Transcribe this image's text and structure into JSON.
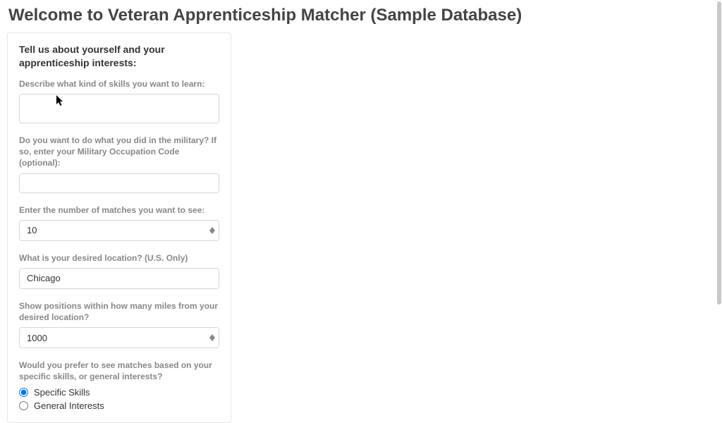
{
  "page": {
    "title": "Welcome to Veteran Apprenticeship Matcher (Sample Database)"
  },
  "form": {
    "intro": "Tell us about yourself and your apprenticeship interests:",
    "skills": {
      "label": "Describe what kind of skills you want to learn:",
      "value": ""
    },
    "military_code": {
      "label": "Do you want to do what you did in the military? If so, enter your Military Occupation Code (optional):",
      "value": ""
    },
    "num_matches": {
      "label": "Enter the number of matches you want to see:",
      "value": "10"
    },
    "location": {
      "label": "What is your desired location? (U.S. Only)",
      "value": "Chicago"
    },
    "radius": {
      "label": "Show positions within how many miles from your desired location?",
      "value": "1000"
    },
    "preference": {
      "label": "Would you prefer to see matches based on your specific skills, or general interests?",
      "options": {
        "specific": "Specific Skills",
        "general": "General Interests"
      },
      "selected": "specific"
    }
  }
}
